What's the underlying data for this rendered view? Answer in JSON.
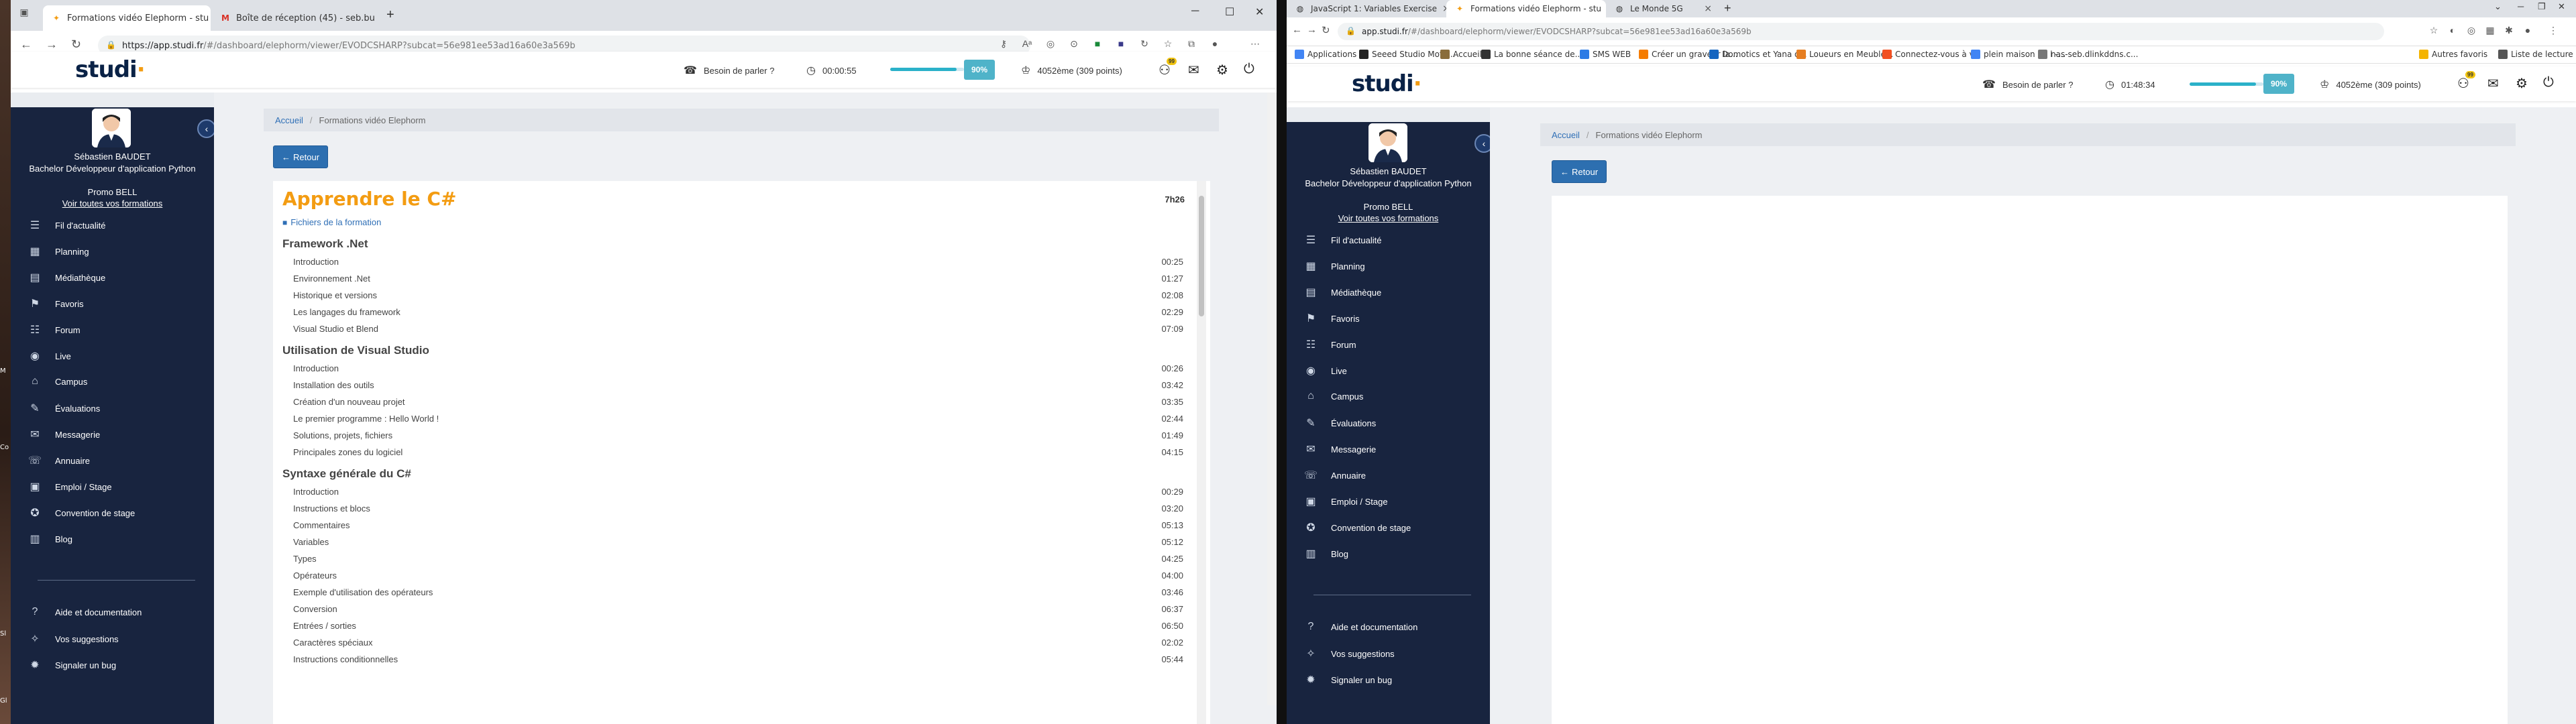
{
  "desktop": {
    "labels": [
      "M",
      "Co",
      "Sl",
      "Gl"
    ]
  },
  "win1": {
    "tabs": [
      {
        "title": "Formations vidéo Elephorm - stu",
        "icon": "studi-favicon",
        "active": true
      },
      {
        "title": "Boîte de réception (45) - seb.bu",
        "icon": "gmail-icon",
        "active": false
      }
    ],
    "url_host": "https://app.studi.fr",
    "url_path": "/#/dashboard/elephorm/viewer/EVODCSHARP?subcat=56e981ee53ad16a60e3a569b",
    "header": {
      "help": "Besoin de parler ?",
      "timer": "00:00:55",
      "progress": "90%",
      "progress_value": 0.9,
      "points": "4052ème (309 points)",
      "notif_count": "99"
    },
    "user": {
      "name": "Sébastien BAUDET",
      "program": "Bachelor Développeur d'application Python",
      "promo": "Promo BELL",
      "all_link": "Voir toutes vos formations"
    },
    "menu": [
      {
        "label": "Fil d'actualité",
        "icon": "news-icon"
      },
      {
        "label": "Planning",
        "icon": "calendar-icon"
      },
      {
        "label": "Médiathèque",
        "icon": "library-icon"
      },
      {
        "label": "Favoris",
        "icon": "bookmark-icon"
      },
      {
        "label": "Forum",
        "icon": "forum-icon"
      },
      {
        "label": "Live",
        "icon": "live-icon"
      },
      {
        "label": "Campus",
        "icon": "campus-icon"
      },
      {
        "label": "Évaluations",
        "icon": "evaluation-icon"
      },
      {
        "label": "Messagerie",
        "icon": "mail-icon"
      },
      {
        "label": "Annuaire",
        "icon": "directory-icon"
      },
      {
        "label": "Emploi / Stage",
        "icon": "briefcase-icon"
      },
      {
        "label": "Convention de stage",
        "icon": "graduation-icon"
      },
      {
        "label": "Blog",
        "icon": "blog-icon"
      }
    ],
    "menu_bottom": [
      {
        "label": "Aide et documentation",
        "icon": "help-icon"
      },
      {
        "label": "Vos suggestions",
        "icon": "suggestion-icon"
      },
      {
        "label": "Signaler un bug",
        "icon": "bug-icon"
      }
    ],
    "breadcrumb": {
      "home": "Accueil",
      "current": "Formations vidéo Elephorm"
    },
    "back_label": "Retour",
    "course": {
      "title": "Apprendre le C#",
      "duration": "7h26",
      "files_label": "Fichiers de la formation",
      "chapters": [
        {
          "title": "Framework .Net",
          "lessons": [
            {
              "name": "Introduction",
              "dur": "00:25"
            },
            {
              "name": "Environnement .Net",
              "dur": "01:27"
            },
            {
              "name": "Historique et versions",
              "dur": "02:08"
            },
            {
              "name": "Les langages du framework",
              "dur": "02:29"
            },
            {
              "name": "Visual Studio et Blend",
              "dur": "07:09"
            }
          ]
        },
        {
          "title": "Utilisation de Visual Studio",
          "lessons": [
            {
              "name": "Introduction",
              "dur": "00:26"
            },
            {
              "name": "Installation des outils",
              "dur": "03:42"
            },
            {
              "name": "Création d'un nouveau projet",
              "dur": "03:35"
            },
            {
              "name": "Le premier programme : Hello World !",
              "dur": "02:44"
            },
            {
              "name": "Solutions, projets, fichiers",
              "dur": "01:49"
            },
            {
              "name": "Principales zones du logiciel",
              "dur": "04:15"
            }
          ]
        },
        {
          "title": "Syntaxe générale du C#",
          "lessons": [
            {
              "name": "Introduction",
              "dur": "00:29"
            },
            {
              "name": "Instructions et blocs",
              "dur": "03:20"
            },
            {
              "name": "Commentaires",
              "dur": "05:13"
            },
            {
              "name": "Variables",
              "dur": "05:12"
            },
            {
              "name": "Types",
              "dur": "04:25"
            },
            {
              "name": "Opérateurs",
              "dur": "04:00"
            },
            {
              "name": "Exemple d'utilisation des opérateurs",
              "dur": "03:46"
            },
            {
              "name": "Conversion",
              "dur": "06:37"
            },
            {
              "name": "Entrées / sorties",
              "dur": "06:50"
            },
            {
              "name": "Caractères spéciaux",
              "dur": "02:02"
            },
            {
              "name": "Instructions conditionnelles",
              "dur": "05:44"
            }
          ]
        }
      ]
    }
  },
  "win2": {
    "tabs": [
      {
        "title": "JavaScript 1: Variables Exercise",
        "icon": "globe-icon",
        "active": false
      },
      {
        "title": "Formations vidéo Elephorm - stu",
        "icon": "studi-favicon",
        "active": true
      },
      {
        "title": "Le Monde 5G",
        "icon": "globe-icon",
        "active": false
      }
    ],
    "url_host": "app.studi.fr",
    "url_path": "/#/dashboard/elephorm/viewer/EVODCSHARP?subcat=56e981ee53ad16a60e3a569b",
    "bookmarks": [
      {
        "label": "Applications",
        "icon": "apps-icon",
        "color": "#4285f4"
      },
      {
        "label": "Seeed Studio Mote...",
        "icon": "seeed-icon",
        "color": "#222222"
      },
      {
        "label": "Accueil",
        "icon": "home-icon",
        "color": "#8a6d3b"
      },
      {
        "label": "La bonne séance de...",
        "icon": "lw-icon",
        "color": "#333333"
      },
      {
        "label": "SMS WEB",
        "icon": "sms-icon",
        "color": "#2c7be5"
      },
      {
        "label": "Créer un graveur la...",
        "icon": "blogger-icon",
        "color": "#f57c00"
      },
      {
        "label": "Domotics et Yana o...",
        "icon": "domotic-icon",
        "color": "#1565c0"
      },
      {
        "label": "Loueurs en Meublé...",
        "icon": "link-icon",
        "color": "#e67e22"
      },
      {
        "label": "Connectez-vous à v...",
        "icon": "ms-icon",
        "color": "#f25022"
      },
      {
        "label": "plein maison en l -...",
        "icon": "google-icon",
        "color": "#4285f4"
      },
      {
        "label": "nas-seb.dlinkddns.c...",
        "icon": "page-icon",
        "color": "#777777"
      }
    ],
    "bookmarks_right": [
      {
        "label": "Autres favoris",
        "icon": "folder-icon",
        "color": "#f4b400"
      },
      {
        "label": "Liste de lecture",
        "icon": "reading-list-icon",
        "color": "#555555"
      }
    ],
    "header": {
      "help": "Besoin de parler ?",
      "timer": "01:48:34",
      "progress": "90%",
      "progress_value": 0.9,
      "points": "4052ème (309 points)",
      "notif_count": "99"
    },
    "user": {
      "name": "Sébastien BAUDET",
      "program": "Bachelor Développeur d'application Python",
      "promo": "Promo BELL",
      "all_link": "Voir toutes vos formations"
    },
    "menu": [
      {
        "label": "Fil d'actualité",
        "icon": "news-icon"
      },
      {
        "label": "Planning",
        "icon": "calendar-icon"
      },
      {
        "label": "Médiathèque",
        "icon": "library-icon"
      },
      {
        "label": "Favoris",
        "icon": "bookmark-icon"
      },
      {
        "label": "Forum",
        "icon": "forum-icon"
      },
      {
        "label": "Live",
        "icon": "live-icon"
      },
      {
        "label": "Campus",
        "icon": "campus-icon"
      },
      {
        "label": "Évaluations",
        "icon": "evaluation-icon"
      },
      {
        "label": "Messagerie",
        "icon": "mail-icon"
      },
      {
        "label": "Annuaire",
        "icon": "directory-icon"
      },
      {
        "label": "Emploi / Stage",
        "icon": "briefcase-icon"
      },
      {
        "label": "Convention de stage",
        "icon": "graduation-icon"
      },
      {
        "label": "Blog",
        "icon": "blog-icon"
      }
    ],
    "menu_bottom": [
      {
        "label": "Aide et documentation",
        "icon": "help-icon"
      },
      {
        "label": "Vos suggestions",
        "icon": "suggestion-icon"
      },
      {
        "label": "Signaler un bug",
        "icon": "bug-icon"
      }
    ],
    "breadcrumb": {
      "home": "Accueil",
      "current": "Formations vidéo Elephorm"
    },
    "back_label": "Retour"
  },
  "colors": {
    "accent_orange": "#f39c12",
    "sidebar_navy": "#18243f",
    "button_blue": "#2d6fb0",
    "progress_teal": "#4fb3c9"
  }
}
